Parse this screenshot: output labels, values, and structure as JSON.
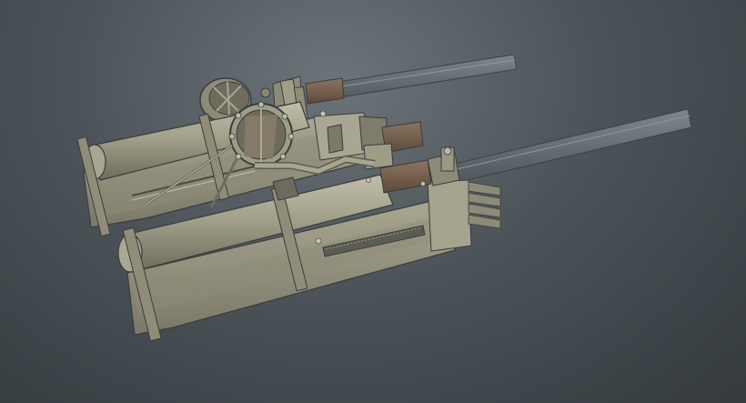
{
  "scene": {
    "subject": "odm-gear-3d-model",
    "colors": {
      "background_light": "#6b7479",
      "background_dark": "#343a3e",
      "metal_body": "#9d9a86",
      "metal_body_light": "#b3b09c",
      "metal_body_dark": "#6f6c5d",
      "blade": "#5f6a6f",
      "blade_edge": "#7a858a",
      "wood_handle": "#6e5848",
      "wood_handle_light": "#8a7260",
      "outline": "#2e3234"
    }
  }
}
